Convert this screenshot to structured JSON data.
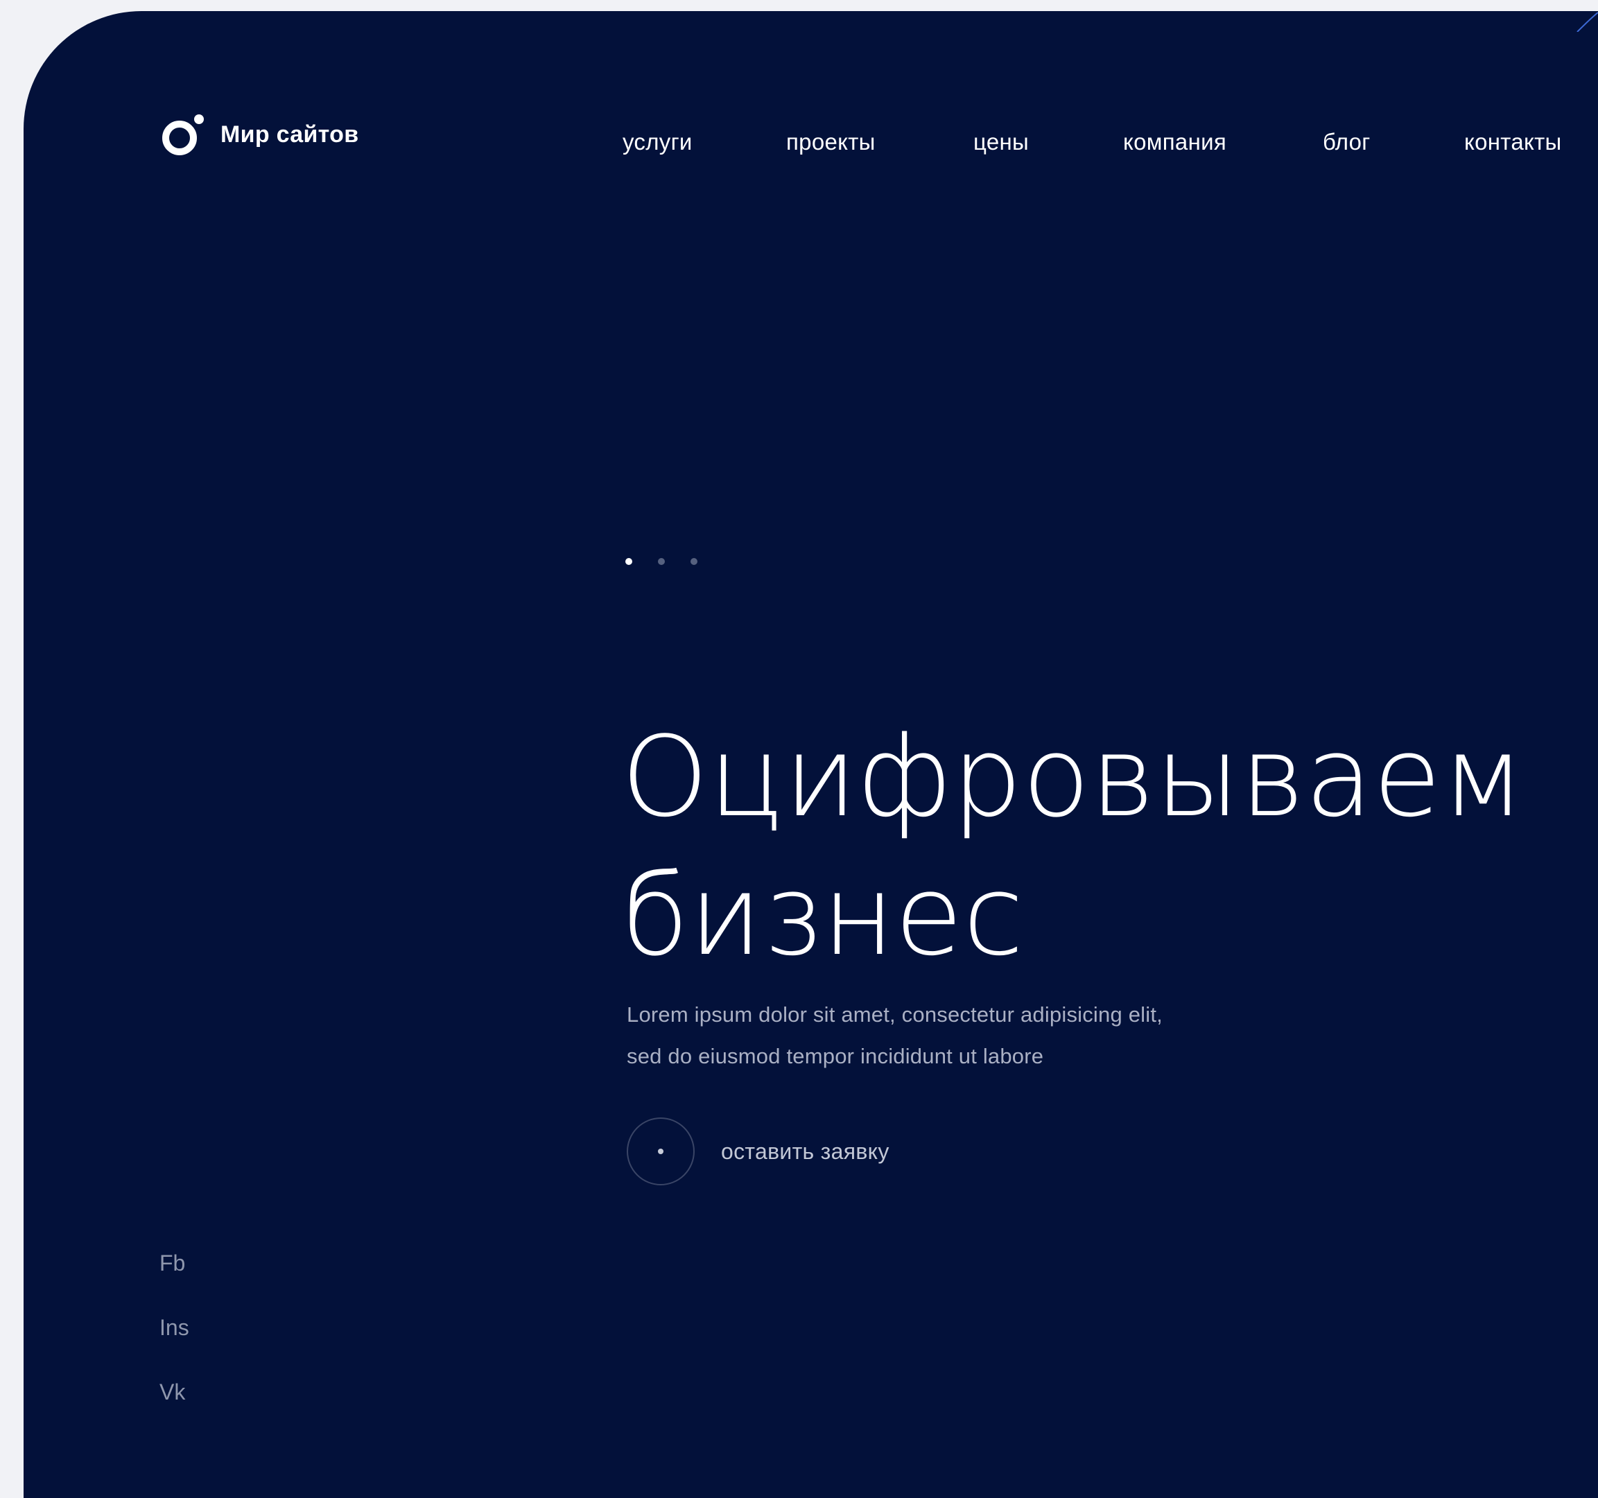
{
  "brand": {
    "name": "Мир сайтов",
    "logo_icon": "ring-with-dot-logo"
  },
  "nav": {
    "items": [
      {
        "label": "услуги"
      },
      {
        "label": "проекты"
      },
      {
        "label": "цены"
      },
      {
        "label": "компания"
      },
      {
        "label": "блог"
      },
      {
        "label": "контакты"
      }
    ]
  },
  "slider": {
    "slide_count": 3,
    "active_index": 0
  },
  "hero": {
    "title_line1": "Оцифровываем",
    "title_line2": "бизнес",
    "subtitle_line1": "Lorem ipsum dolor sit amet, consectetur adipisicing elit,",
    "subtitle_line2": "sed do eiusmod tempor incididunt ut labore",
    "cta_label": "оставить заявку"
  },
  "socials": {
    "items": [
      {
        "label": "Fb"
      },
      {
        "label": "Ins"
      },
      {
        "label": "Vk"
      }
    ]
  },
  "colors": {
    "background": "#03113a",
    "page": "#f1f2f6",
    "text_primary": "#ffffff",
    "text_muted": "#aab0c4"
  }
}
